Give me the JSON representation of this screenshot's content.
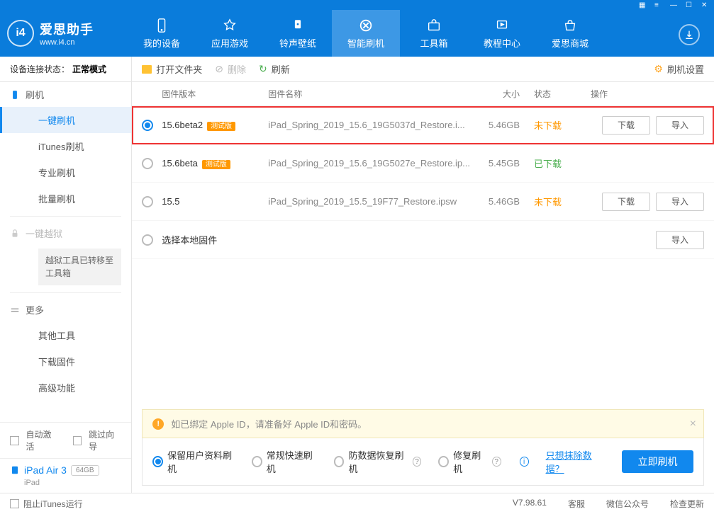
{
  "titlebar": {
    "icons": [
      "grid",
      "menu",
      "min",
      "max",
      "close"
    ]
  },
  "logo": {
    "title": "爱思助手",
    "sub": "www.i4.cn",
    "mark": "i4"
  },
  "nav": [
    {
      "id": "device",
      "label": "我的设备"
    },
    {
      "id": "apps",
      "label": "应用游戏"
    },
    {
      "id": "ring",
      "label": "铃声壁纸"
    },
    {
      "id": "flash",
      "label": "智能刷机",
      "active": true
    },
    {
      "id": "tools",
      "label": "工具箱"
    },
    {
      "id": "tutorial",
      "label": "教程中心"
    },
    {
      "id": "store",
      "label": "爱思商城"
    }
  ],
  "conn": {
    "label": "设备连接状态：",
    "mode": "正常模式"
  },
  "sidebar": {
    "flash_group": "刷机",
    "items1": [
      "一键刷机",
      "iTunes刷机",
      "专业刷机",
      "批量刷机"
    ],
    "jailbreak": "一键越狱",
    "jb_note": "越狱工具已转移至工具箱",
    "more_group": "更多",
    "items2": [
      "其他工具",
      "下载固件",
      "高级功能"
    ],
    "auto_activate": "自动激活",
    "skip_guide": "跳过向导",
    "device_name": "iPad Air 3",
    "device_cap": "64GB",
    "device_type": "iPad"
  },
  "toolbar": {
    "open": "打开文件夹",
    "delete": "删除",
    "refresh": "刷新",
    "settings": "刷机设置"
  },
  "cols": {
    "ver": "固件版本",
    "name": "固件名称",
    "size": "大小",
    "status": "状态",
    "ops": "操作"
  },
  "rows": [
    {
      "selected": true,
      "highlight": true,
      "ver": "15.6beta2",
      "beta": "测试版",
      "name": "iPad_Spring_2019_15.6_19G5037d_Restore.i...",
      "size": "5.46GB",
      "status": "未下载",
      "st_cls": "st-undl",
      "ops": [
        "下载",
        "导入"
      ]
    },
    {
      "selected": false,
      "ver": "15.6beta",
      "beta": "测试版",
      "name": "iPad_Spring_2019_15.6_19G5027e_Restore.ip...",
      "size": "5.45GB",
      "status": "已下载",
      "st_cls": "st-dl",
      "ops": []
    },
    {
      "selected": false,
      "ver": "15.5",
      "beta": "",
      "name": "iPad_Spring_2019_15.5_19F77_Restore.ipsw",
      "size": "5.46GB",
      "status": "未下载",
      "st_cls": "st-undl",
      "ops": [
        "下载",
        "导入"
      ]
    },
    {
      "selected": false,
      "ver": "选择本地固件",
      "beta": "",
      "name": "",
      "size": "",
      "status": "",
      "st_cls": "",
      "ops": [
        "导入"
      ]
    }
  ],
  "notice": "如已绑定 Apple ID，请准备好 Apple ID和密码。",
  "modes": [
    {
      "label": "保留用户资料刷机",
      "checked": true
    },
    {
      "label": "常规快速刷机",
      "checked": false
    },
    {
      "label": "防数据恢复刷机",
      "checked": false,
      "help": true
    },
    {
      "label": "修复刷机",
      "checked": false,
      "help": true
    }
  ],
  "erase_link": "只想抹除数据？",
  "flash_btn": "立即刷机",
  "footer": {
    "block_itunes": "阻止iTunes运行",
    "version": "V7.98.61",
    "links": [
      "客服",
      "微信公众号",
      "检查更新"
    ]
  }
}
